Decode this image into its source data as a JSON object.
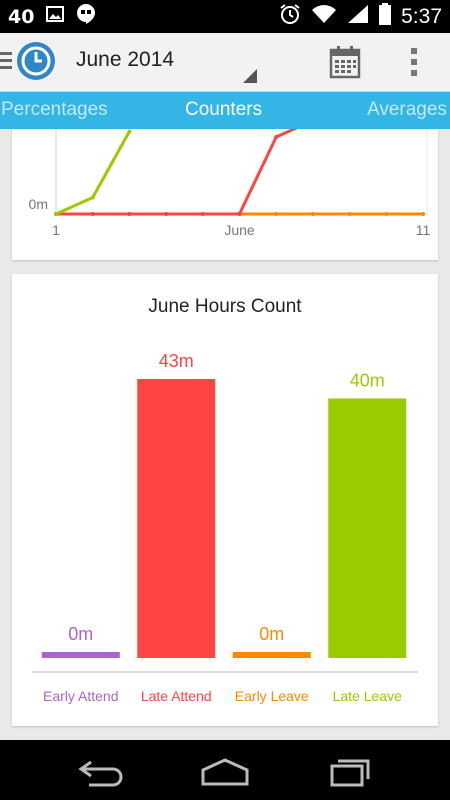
{
  "status_bar": {
    "notification_count": "40",
    "time": "5:37",
    "icons": [
      "image-icon",
      "hangouts-icon",
      "alarm-icon",
      "wifi-icon",
      "signal-icon",
      "battery-icon"
    ]
  },
  "action_bar": {
    "title": "June 2014",
    "icons": [
      "menu-icon",
      "app-clock-icon",
      "dropdown-arrow-icon",
      "calendar-icon",
      "overflow-menu-icon"
    ]
  },
  "tabs": [
    {
      "label": "Percentages",
      "active": false
    },
    {
      "label": "Counters",
      "active": true
    },
    {
      "label": "Averages",
      "active": false
    }
  ],
  "line_chart": {
    "y_tick": "0m",
    "x_ticks": [
      "1",
      "June",
      "11"
    ]
  },
  "chart_data": [
    {
      "type": "line",
      "x": [
        1,
        2,
        3,
        4,
        5,
        6,
        7,
        8,
        9,
        10,
        11
      ],
      "x_tick_labels": [
        "1",
        "June",
        "11"
      ],
      "y_tick_labels": [
        "0m"
      ],
      "series": [
        {
          "color": "#99cc00",
          "values": [
            0,
            3,
            15,
            null,
            null,
            null,
            null,
            null,
            null,
            null,
            null
          ]
        },
        {
          "color": "#ff4444",
          "values": [
            0,
            0,
            0,
            0,
            0,
            0,
            14,
            17,
            20,
            null,
            null
          ]
        },
        {
          "color": "#ff8800",
          "values": [
            0,
            0,
            0,
            0,
            0,
            0,
            0,
            0,
            0,
            0,
            0
          ]
        }
      ]
    },
    {
      "type": "bar",
      "title": "June Hours Count",
      "categories": [
        "Early Attend",
        "Late Attend",
        "Early Leave",
        "Late Leave"
      ],
      "values": [
        0,
        43,
        0,
        40
      ],
      "value_labels": [
        "0m",
        "43m",
        "0m",
        "40m"
      ],
      "colors": [
        "#aa66cc",
        "#ff4444",
        "#ff8800",
        "#99cc00"
      ],
      "ylim": [
        0,
        43
      ]
    }
  ]
}
